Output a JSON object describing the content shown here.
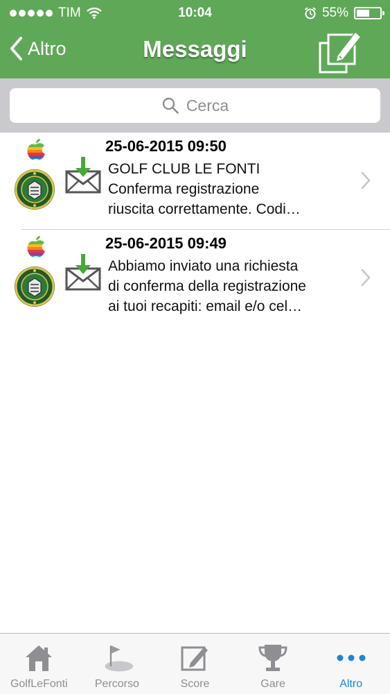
{
  "status_bar": {
    "carrier": "TIM",
    "time": "10:04",
    "battery": "55%",
    "battery_level": 0.55
  },
  "nav": {
    "back_label": "Altro",
    "title": "Messaggi"
  },
  "search": {
    "placeholder": "Cerca"
  },
  "messages": [
    {
      "date": "25-06-2015 09:50",
      "lines": [
        "GOLF CLUB LE FONTI",
        "Conferma registrazione",
        "riuscita correttamente.  Codi…"
      ]
    },
    {
      "date": "25-06-2015 09:49",
      "lines": [
        "Abbiamo inviato una richiesta",
        "di conferma della registrazione",
        "ai tuoi recapiti: email e/o cel…"
      ]
    }
  ],
  "tabs": [
    {
      "label": "GolfLeFonti",
      "icon": "house-icon"
    },
    {
      "label": "Percorso",
      "icon": "golf-flag-icon"
    },
    {
      "label": "Score",
      "icon": "scorecard-pencil-icon"
    },
    {
      "label": "Gare",
      "icon": "trophy-icon"
    },
    {
      "label": "Altro",
      "icon": "more-dots-icon",
      "active": true
    }
  ],
  "colors": {
    "header_green": "#5fa858",
    "active_tab": "#1e86d8",
    "inactive_tab": "#8e8e93"
  }
}
